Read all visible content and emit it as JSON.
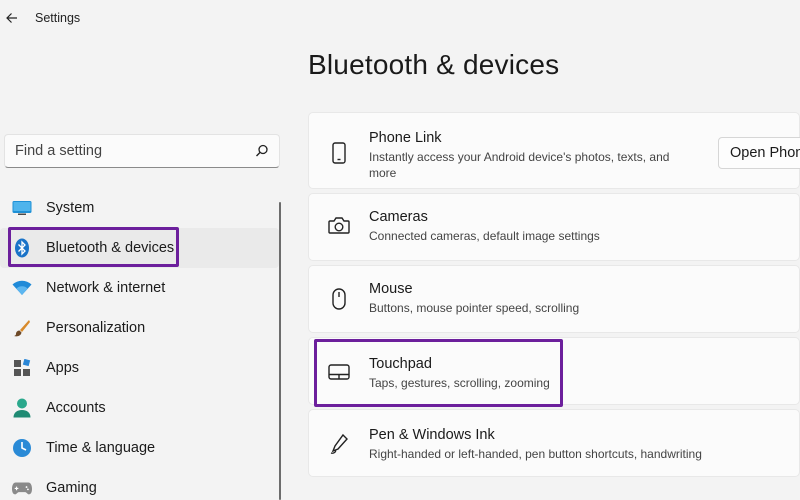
{
  "window": {
    "title": "Settings"
  },
  "search": {
    "placeholder": "Find a setting"
  },
  "sidebar": {
    "items": [
      {
        "label": "System"
      },
      {
        "label": "Bluetooth & devices"
      },
      {
        "label": "Network & internet"
      },
      {
        "label": "Personalization"
      },
      {
        "label": "Apps"
      },
      {
        "label": "Accounts"
      },
      {
        "label": "Time & language"
      },
      {
        "label": "Gaming"
      }
    ],
    "active": "Bluetooth & devices"
  },
  "main": {
    "title": "Bluetooth & devices",
    "cards": [
      {
        "title": "Phone Link",
        "desc": "Instantly access your Android device's photos, texts, and more",
        "button": "Open Phone Link"
      },
      {
        "title": "Cameras",
        "desc": "Connected cameras, default image settings"
      },
      {
        "title": "Mouse",
        "desc": "Buttons, mouse pointer speed, scrolling"
      },
      {
        "title": "Touchpad",
        "desc": "Taps, gestures, scrolling, zooming"
      },
      {
        "title": "Pen & Windows Ink",
        "desc": "Right-handed or left-handed, pen button shortcuts, handwriting"
      }
    ]
  },
  "colors": {
    "highlight": "#6c1f9c",
    "accent": "#0067c0"
  }
}
